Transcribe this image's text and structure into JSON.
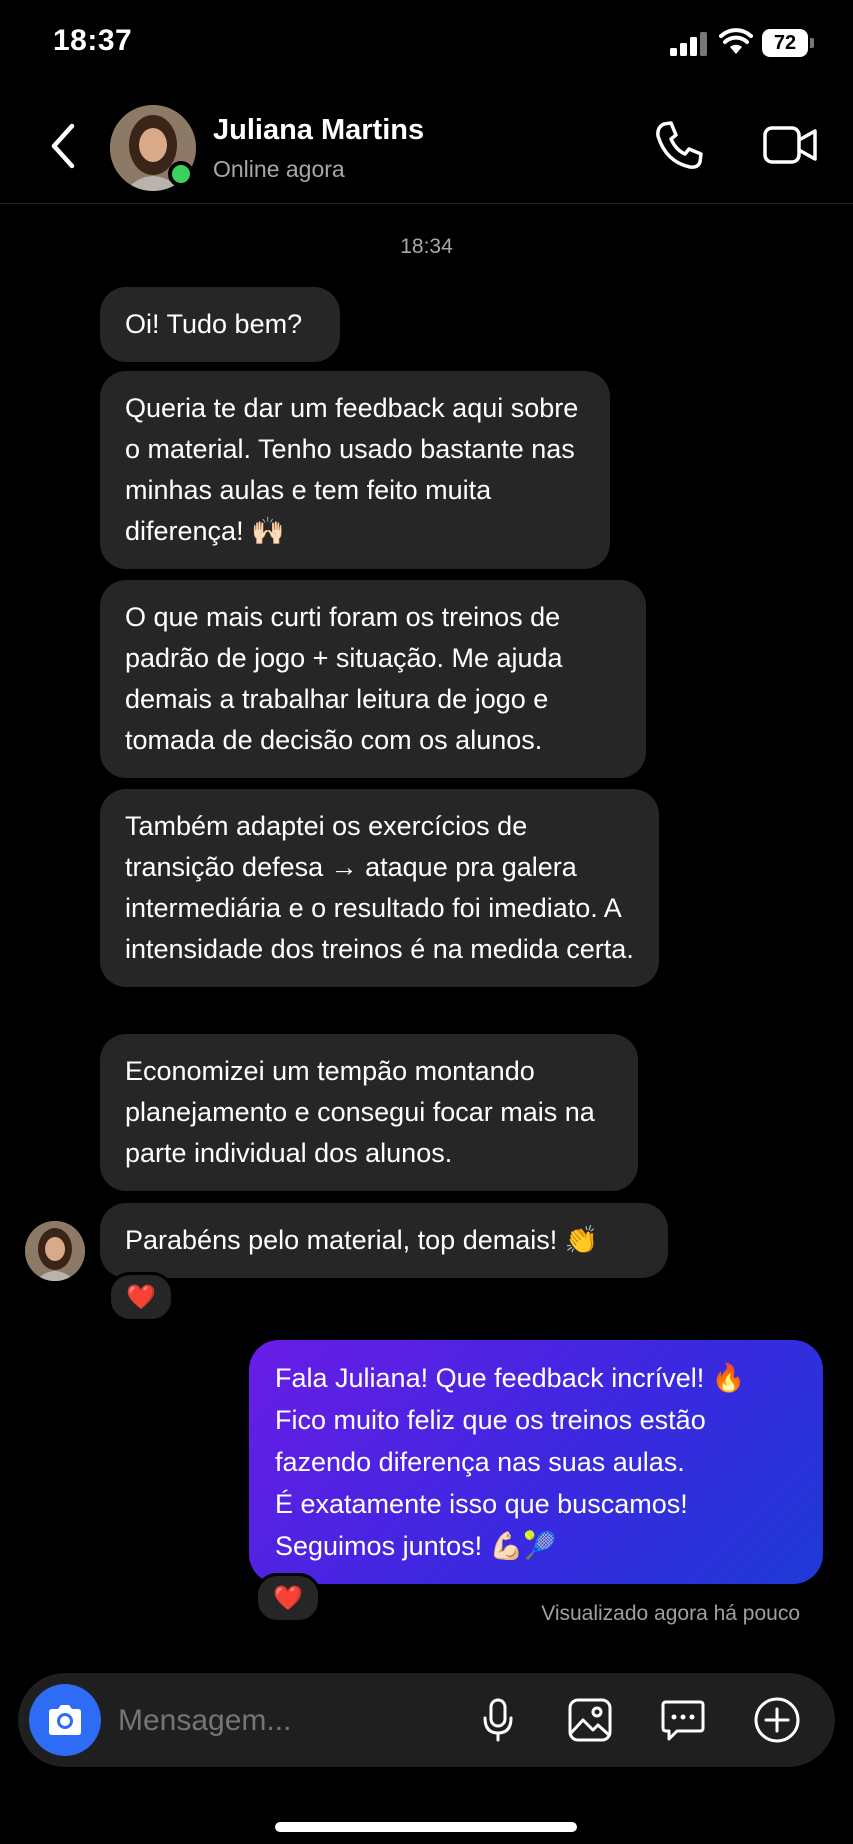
{
  "status_bar": {
    "time": "18:37",
    "battery": "72"
  },
  "header": {
    "name": "Juliana Martins",
    "status": "Online agora"
  },
  "chat": {
    "timestamp": "18:34",
    "messages": [
      {
        "text": "Oi! Tudo bem?"
      },
      {
        "text": "Queria te dar um feedback aqui sobre o material. Tenho usado bastante nas minhas aulas e tem feito muita diferença! 🙌🏻"
      },
      {
        "text": "O que mais curti foram os treinos de padrão de jogo + situação. Me ajuda demais a trabalhar leitura de jogo e tomada de decisão com os alunos."
      },
      {
        "text": "Também adaptei os exercícios de transição defesa → ataque pra galera intermediária e o resultado foi imediato. A intensidade dos treinos é na medida certa."
      },
      {
        "text": "Economizei um tempão montando planejamento e consegui focar mais na parte individual dos alunos."
      },
      {
        "text": "Parabéns pelo material, top demais! 👏",
        "reaction": "❤️"
      }
    ],
    "outgoing": {
      "lines": [
        "Fala Juliana! Que feedback incrível! 🔥",
        "Fico muito feliz que os treinos estão",
        "fazendo diferença nas suas aulas.",
        "É exatamente isso que buscamos!",
        "Seguimos juntos! 💪🏻🎾"
      ],
      "reaction": "❤️"
    },
    "seen": "Visualizado agora há pouco"
  },
  "composer": {
    "placeholder": "Mensagem..."
  },
  "colors": {
    "bubble_in": "#262626",
    "accent": "#2f6cf6",
    "online": "#3ad15d"
  }
}
